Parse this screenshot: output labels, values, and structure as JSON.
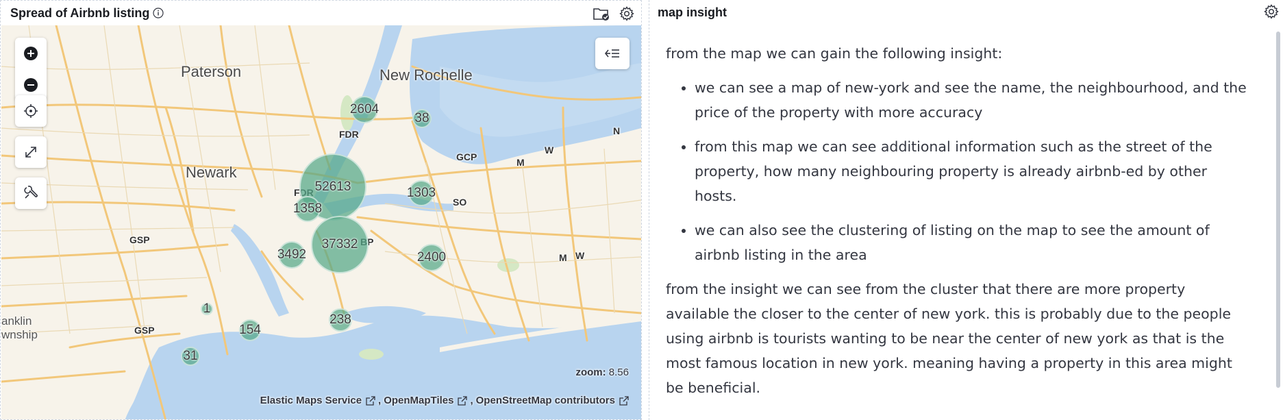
{
  "map_panel": {
    "title": "Spread of Airbnb listing",
    "zoom_label": "zoom:",
    "zoom_value": "8.56",
    "attribution": [
      "Elastic Maps Service",
      "OpenMapTiles",
      "OpenStreetMap contributors"
    ],
    "place_labels": [
      "Paterson",
      "New Rochelle",
      "Newark",
      "anklin",
      "wnship"
    ],
    "road_labels": [
      "FDR",
      "FDR",
      "GCP",
      "SO",
      "BP",
      "GSP",
      "GSP",
      "N",
      "W",
      "M",
      "M",
      "W"
    ],
    "clusters": [
      {
        "count": "52613"
      },
      {
        "count": "37332"
      },
      {
        "count": "3492"
      },
      {
        "count": "2604"
      },
      {
        "count": "2400"
      },
      {
        "count": "1358"
      },
      {
        "count": "1303"
      },
      {
        "count": "238"
      },
      {
        "count": "154"
      },
      {
        "count": "38"
      },
      {
        "count": "31"
      },
      {
        "count": "1"
      }
    ],
    "colors": {
      "water": "#b8d4ef",
      "land": "#f7f3ea",
      "road": "#f2c77a",
      "cluster": "#54a888"
    }
  },
  "insight_panel": {
    "title": "map insight",
    "intro": "from the map we can gain the following insight:",
    "bullets": [
      "we can see a map of new-york and see the name, the neighbourhood, and the price of the property with more accuracy",
      "from this map we can see additional information such as the street of the property, how many neighbouring property is already airbnb-ed by other hosts.",
      "we can also see the clustering of listing on the map to see the amount of airbnb listing in the area"
    ],
    "conclusion": "from the insight we can see from the cluster that there are more property available the closer to the center of new york. this is probably due to the people using airbnb is tourists wanting to be near the center of new york as that is the most famous location in new york. meaning having a property in this area might be beneficial."
  }
}
